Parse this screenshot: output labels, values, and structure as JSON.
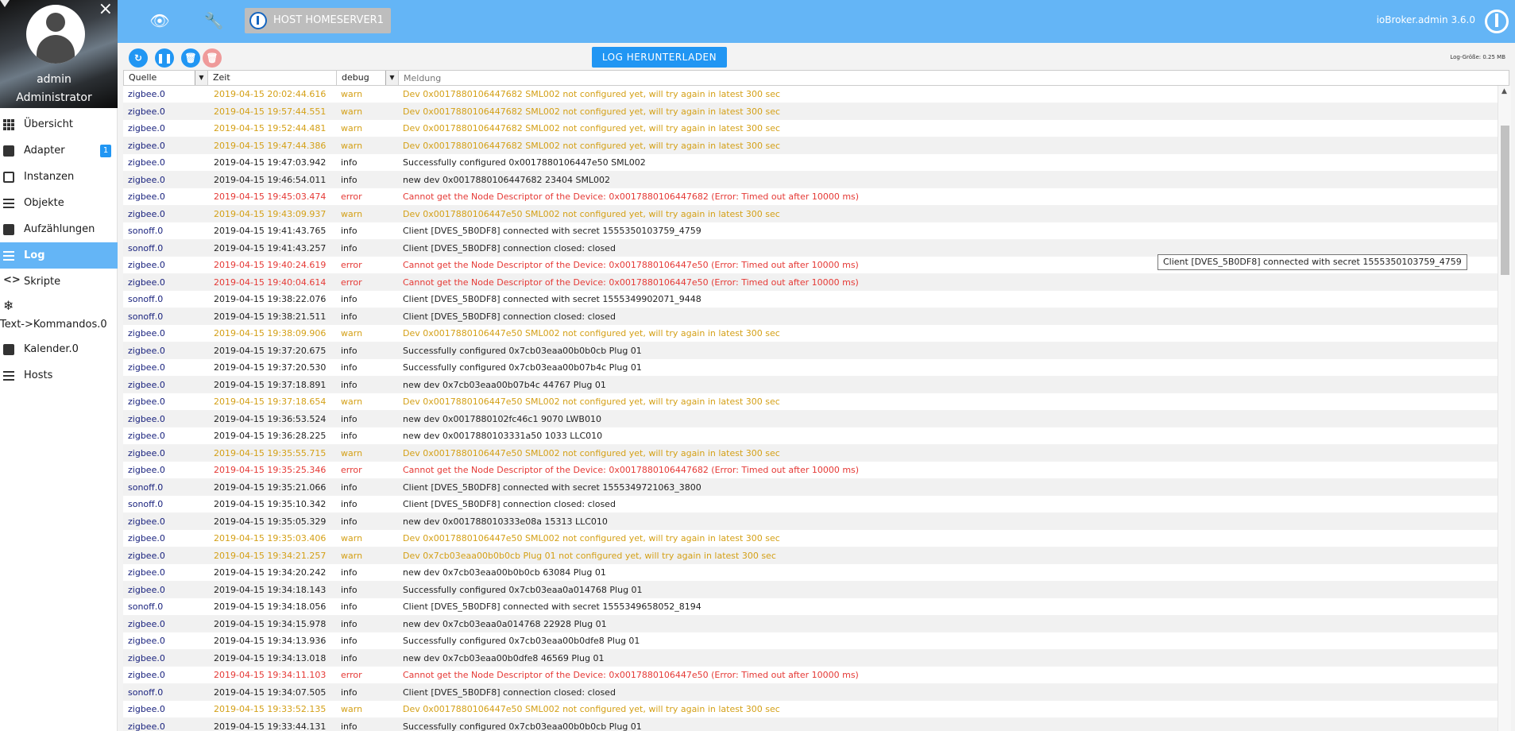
{
  "user": {
    "name": "admin",
    "role": "Administrator"
  },
  "nav": [
    {
      "label": "Übersicht",
      "icon": "grid-icon"
    },
    {
      "label": "Adapter",
      "icon": "store-icon",
      "badge": "1"
    },
    {
      "label": "Instanzen",
      "icon": "memory-icon"
    },
    {
      "label": "Objekte",
      "icon": "list-icon"
    },
    {
      "label": "Aufzählungen",
      "icon": "enum-icon"
    },
    {
      "label": "Log",
      "icon": "menu-icon",
      "active": true
    },
    {
      "label": "Skripte",
      "icon": "code-icon"
    },
    {
      "label": "Text->Kommandos.0",
      "icon": "snowflake-icon"
    },
    {
      "label": "Kalender.0",
      "icon": "calendar-icon"
    },
    {
      "label": "Hosts",
      "icon": "hosts-icon"
    }
  ],
  "topbar": {
    "host_label": "HOST HOMESERVER1",
    "app_version": "ioBroker.admin 3.6.0"
  },
  "toolbar": {
    "download_label": "LOG HERUNTERLADEN",
    "log_size": "Log-Größe: 0.25 MB"
  },
  "filters": {
    "source": "Quelle",
    "time": "Zeit",
    "level": "debug",
    "message_placeholder": "Meldung"
  },
  "tooltip": "Client [DVES_5B0DF8] connected with secret 1555350103759_4759",
  "colors": {
    "accent": "#64b5f6",
    "button": "#2196f3",
    "warn": "#d4a017",
    "error": "#e53935"
  },
  "log": [
    [
      "zigbee.0",
      "2019-04-15 20:02:44.616",
      "warn",
      "Dev 0x0017880106447682 SML002 not configured yet, will try again in latest 300 sec"
    ],
    [
      "zigbee.0",
      "2019-04-15 19:57:44.551",
      "warn",
      "Dev 0x0017880106447682 SML002 not configured yet, will try again in latest 300 sec"
    ],
    [
      "zigbee.0",
      "2019-04-15 19:52:44.481",
      "warn",
      "Dev 0x0017880106447682 SML002 not configured yet, will try again in latest 300 sec"
    ],
    [
      "zigbee.0",
      "2019-04-15 19:47:44.386",
      "warn",
      "Dev 0x0017880106447682 SML002 not configured yet, will try again in latest 300 sec"
    ],
    [
      "zigbee.0",
      "2019-04-15 19:47:03.942",
      "info",
      "Successfully configured 0x0017880106447e50 SML002"
    ],
    [
      "zigbee.0",
      "2019-04-15 19:46:54.011",
      "info",
      "new dev 0x0017880106447682 23404 SML002"
    ],
    [
      "zigbee.0",
      "2019-04-15 19:45:03.474",
      "error",
      "Cannot get the Node Descriptor of the Device: 0x0017880106447682 (Error: Timed out after 10000 ms)"
    ],
    [
      "zigbee.0",
      "2019-04-15 19:43:09.937",
      "warn",
      "Dev 0x0017880106447e50 SML002 not configured yet, will try again in latest 300 sec"
    ],
    [
      "sonoff.0",
      "2019-04-15 19:41:43.765",
      "info",
      "Client [DVES_5B0DF8] connected with secret 1555350103759_4759"
    ],
    [
      "sonoff.0",
      "2019-04-15 19:41:43.257",
      "info",
      "Client [DVES_5B0DF8] connection closed: closed"
    ],
    [
      "zigbee.0",
      "2019-04-15 19:40:24.619",
      "error",
      "Cannot get the Node Descriptor of the Device: 0x0017880106447e50 (Error: Timed out after 10000 ms)"
    ],
    [
      "zigbee.0",
      "2019-04-15 19:40:04.614",
      "error",
      "Cannot get the Node Descriptor of the Device: 0x0017880106447e50 (Error: Timed out after 10000 ms)"
    ],
    [
      "sonoff.0",
      "2019-04-15 19:38:22.076",
      "info",
      "Client [DVES_5B0DF8] connected with secret 1555349902071_9448"
    ],
    [
      "sonoff.0",
      "2019-04-15 19:38:21.511",
      "info",
      "Client [DVES_5B0DF8] connection closed: closed"
    ],
    [
      "zigbee.0",
      "2019-04-15 19:38:09.906",
      "warn",
      "Dev 0x0017880106447e50 SML002 not configured yet, will try again in latest 300 sec"
    ],
    [
      "zigbee.0",
      "2019-04-15 19:37:20.675",
      "info",
      "Successfully configured 0x7cb03eaa00b0b0cb Plug 01"
    ],
    [
      "zigbee.0",
      "2019-04-15 19:37:20.530",
      "info",
      "Successfully configured 0x7cb03eaa00b07b4c Plug 01"
    ],
    [
      "zigbee.0",
      "2019-04-15 19:37:18.891",
      "info",
      "new dev 0x7cb03eaa00b07b4c 44767 Plug 01"
    ],
    [
      "zigbee.0",
      "2019-04-15 19:37:18.654",
      "warn",
      "Dev 0x0017880106447e50 SML002 not configured yet, will try again in latest 300 sec"
    ],
    [
      "zigbee.0",
      "2019-04-15 19:36:53.524",
      "info",
      "new dev 0x0017880102fc46c1 9070 LWB010"
    ],
    [
      "zigbee.0",
      "2019-04-15 19:36:28.225",
      "info",
      "new dev 0x0017880103331a50 1033 LLC010"
    ],
    [
      "zigbee.0",
      "2019-04-15 19:35:55.715",
      "warn",
      "Dev 0x0017880106447e50 SML002 not configured yet, will try again in latest 300 sec"
    ],
    [
      "zigbee.0",
      "2019-04-15 19:35:25.346",
      "error",
      "Cannot get the Node Descriptor of the Device: 0x0017880106447682 (Error: Timed out after 10000 ms)"
    ],
    [
      "sonoff.0",
      "2019-04-15 19:35:21.066",
      "info",
      "Client [DVES_5B0DF8] connected with secret 1555349721063_3800"
    ],
    [
      "sonoff.0",
      "2019-04-15 19:35:10.342",
      "info",
      "Client [DVES_5B0DF8] connection closed: closed"
    ],
    [
      "zigbee.0",
      "2019-04-15 19:35:05.329",
      "info",
      "new dev 0x001788010333e08a 15313 LLC010"
    ],
    [
      "zigbee.0",
      "2019-04-15 19:35:03.406",
      "warn",
      "Dev 0x0017880106447e50 SML002 not configured yet, will try again in latest 300 sec"
    ],
    [
      "zigbee.0",
      "2019-04-15 19:34:21.257",
      "warn",
      "Dev 0x7cb03eaa00b0b0cb Plug 01 not configured yet, will try again in latest 300 sec"
    ],
    [
      "zigbee.0",
      "2019-04-15 19:34:20.242",
      "info",
      "new dev 0x7cb03eaa00b0b0cb 63084 Plug 01"
    ],
    [
      "zigbee.0",
      "2019-04-15 19:34:18.143",
      "info",
      "Successfully configured 0x7cb03eaa0a014768 Plug 01"
    ],
    [
      "sonoff.0",
      "2019-04-15 19:34:18.056",
      "info",
      "Client [DVES_5B0DF8] connected with secret 1555349658052_8194"
    ],
    [
      "zigbee.0",
      "2019-04-15 19:34:15.978",
      "info",
      "new dev 0x7cb03eaa0a014768 22928 Plug 01"
    ],
    [
      "zigbee.0",
      "2019-04-15 19:34:13.936",
      "info",
      "Successfully configured 0x7cb03eaa00b0dfe8 Plug 01"
    ],
    [
      "zigbee.0",
      "2019-04-15 19:34:13.018",
      "info",
      "new dev 0x7cb03eaa00b0dfe8 46569 Plug 01"
    ],
    [
      "zigbee.0",
      "2019-04-15 19:34:11.103",
      "error",
      "Cannot get the Node Descriptor of the Device: 0x0017880106447e50 (Error: Timed out after 10000 ms)"
    ],
    [
      "sonoff.0",
      "2019-04-15 19:34:07.505",
      "info",
      "Client [DVES_5B0DF8] connection closed: closed"
    ],
    [
      "zigbee.0",
      "2019-04-15 19:33:52.135",
      "warn",
      "Dev 0x0017880106447e50 SML002 not configured yet, will try again in latest 300 sec"
    ],
    [
      "zigbee.0",
      "2019-04-15 19:33:44.131",
      "info",
      "Successfully configured 0x7cb03eaa00b0b0cb Plug 01"
    ]
  ]
}
